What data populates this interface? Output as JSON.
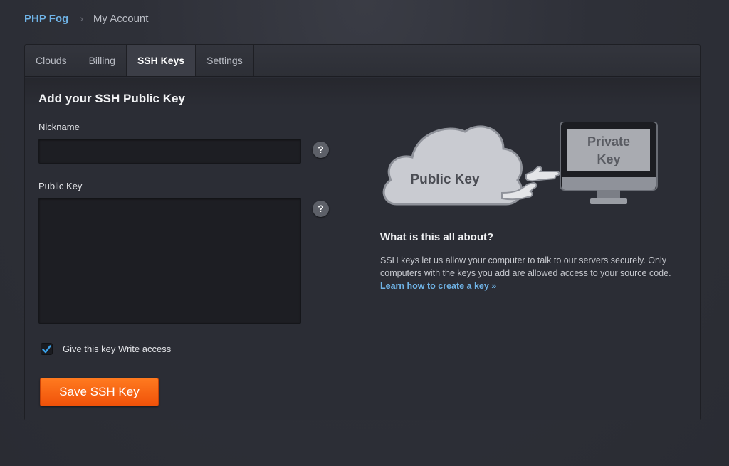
{
  "breadcrumb": {
    "home": "PHP Fog",
    "separator": "›",
    "current": "My Account"
  },
  "tabs": [
    {
      "label": "Clouds",
      "active": false
    },
    {
      "label": "Billing",
      "active": false
    },
    {
      "label": "SSH Keys",
      "active": true
    },
    {
      "label": "Settings",
      "active": false
    }
  ],
  "form": {
    "title": "Add your SSH Public Key",
    "nickname_label": "Nickname",
    "nickname_value": "",
    "public_key_label": "Public Key",
    "public_key_value": "",
    "help_glyph": "?",
    "write_access_label": "Give this key Write access",
    "write_access_checked": true,
    "save_label": "Save SSH Key"
  },
  "illustration": {
    "cloud_label": "Public Key",
    "monitor_label_line1": "Private",
    "monitor_label_line2": "Key"
  },
  "about": {
    "title": "What is this all about?",
    "body": "SSH keys let us allow your computer to talk to our servers securely. Only computers with the keys you add are allowed access to your source code.",
    "link": "Learn how to create a key »"
  },
  "colors": {
    "accent_link": "#6fb3e6",
    "button_orange": "#f5600f",
    "checkbox_check": "#3aa0e8"
  },
  "icons": {
    "help": "question-mark-icon",
    "breadcrumb_separator": "chevron-right-icon",
    "check": "checkmark-icon"
  }
}
